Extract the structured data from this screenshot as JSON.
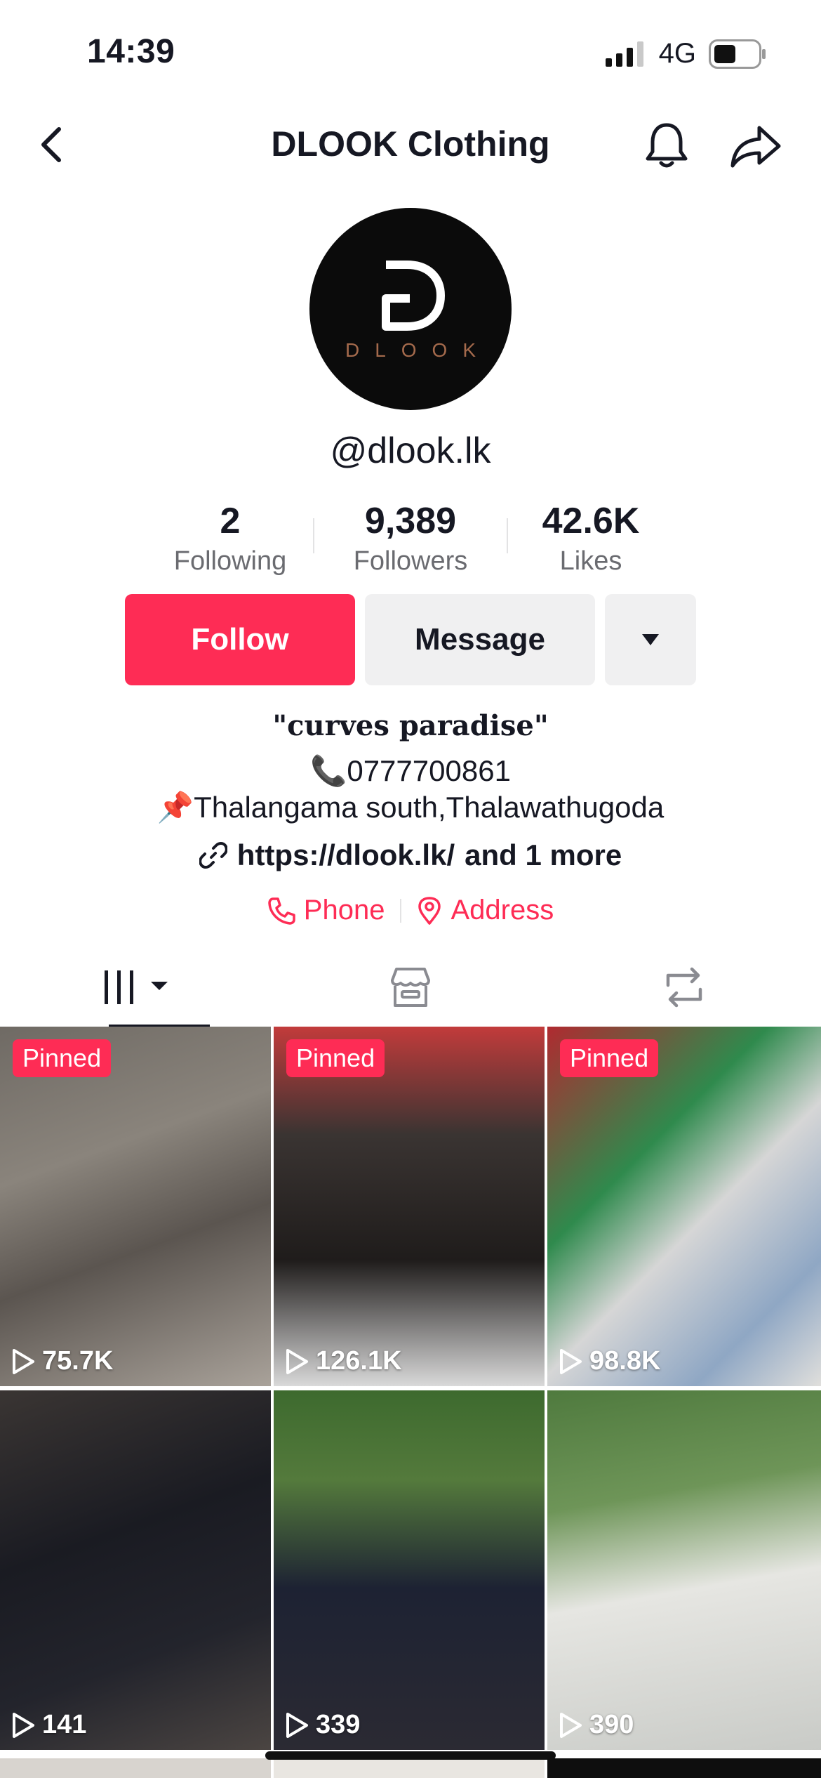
{
  "status": {
    "time": "14:39",
    "network": "4G"
  },
  "header": {
    "title": "DLOOK Clothing"
  },
  "profile": {
    "avatar_letter": "D",
    "avatar_word": "DLOOK",
    "handle": "@dlook.lk",
    "stats": [
      {
        "value": "2",
        "label": "Following"
      },
      {
        "value": "9,389",
        "label": "Followers"
      },
      {
        "value": "42.6K",
        "label": "Likes"
      }
    ]
  },
  "actions": {
    "follow": "Follow",
    "message": "Message"
  },
  "bio": {
    "title": "\"curves paradise\"",
    "phone_line": "📞0777700861",
    "address_line": "📌Thalangama south,Thalawathugoda",
    "link": "https://dlook.lk/",
    "link_more": "and 1 more"
  },
  "contacts": {
    "phone": "Phone",
    "address": "Address"
  },
  "colors": {
    "accent": "#fe2c55",
    "text": "#161823",
    "muted": "#6a6b70"
  },
  "videos": [
    {
      "pinned": "Pinned",
      "views": "75.7K"
    },
    {
      "pinned": "Pinned",
      "views": "126.1K"
    },
    {
      "pinned": "Pinned",
      "views": "98.8K"
    },
    {
      "pinned": "",
      "views": "141"
    },
    {
      "pinned": "",
      "views": "339"
    },
    {
      "pinned": "",
      "views": "390"
    }
  ]
}
